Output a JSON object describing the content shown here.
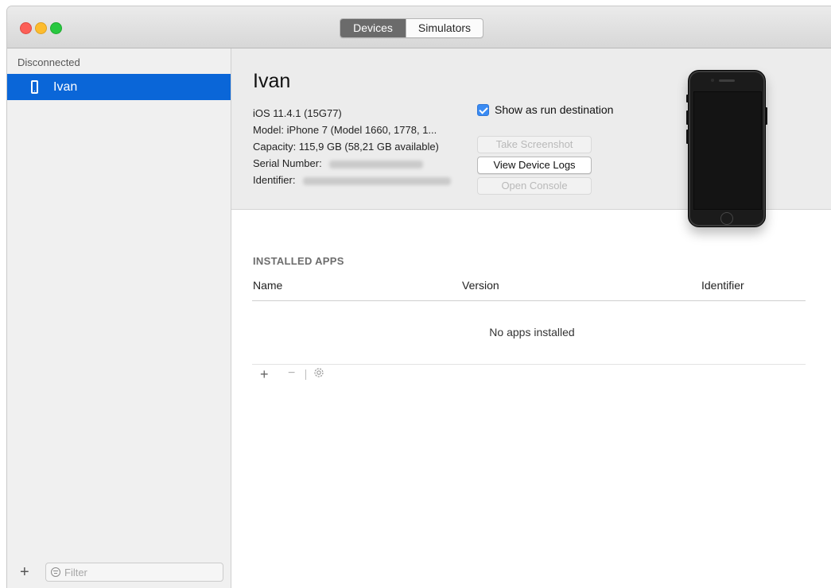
{
  "titlebar": {
    "tabs": [
      {
        "label": "Devices",
        "active": true
      },
      {
        "label": "Simulators",
        "active": false
      }
    ]
  },
  "sidebar": {
    "section_label": "Disconnected",
    "items": [
      {
        "label": "Ivan",
        "icon": "iphone-icon",
        "selected": true
      }
    ],
    "filter_placeholder": "Filter"
  },
  "device": {
    "name": "Ivan",
    "ios": "iOS 11.4.1 (15G77)",
    "model": "Model: iPhone 7 (Model 1660, 1778, 1...",
    "capacity": "Capacity: 115,9 GB (58,21 GB available)",
    "serial_label": "Serial Number:",
    "identifier_label": "Identifier:",
    "show_as_run_destination": "Show as run destination",
    "buttons": {
      "take_screenshot": "Take Screenshot",
      "view_device_logs": "View Device Logs",
      "open_console": "Open Console"
    }
  },
  "apps": {
    "title": "INSTALLED APPS",
    "columns": {
      "name": "Name",
      "version": "Version",
      "identifier": "Identifier"
    },
    "empty_text": "No apps installed",
    "toolbar": {
      "add": "+",
      "remove": "−"
    }
  },
  "colors": {
    "selection": "#0a66d8",
    "checkbox": "#3a8bf3",
    "close": "#fc5f57",
    "minimize": "#fdbc2e",
    "maximize": "#28c840"
  }
}
